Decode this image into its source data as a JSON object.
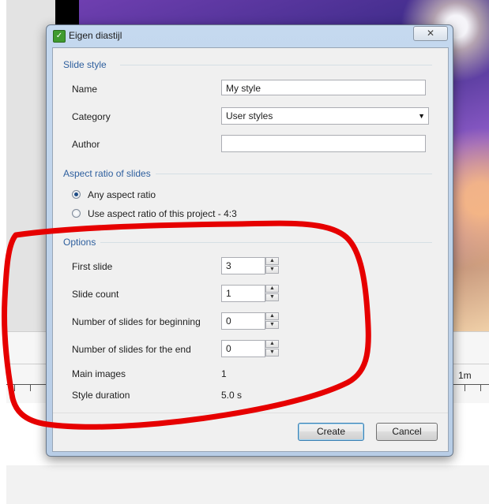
{
  "dialog": {
    "title": "Eigen diastijl",
    "close_glyph": "✕"
  },
  "slide_style": {
    "group_label": "Slide style",
    "name_label": "Name",
    "name_value": "My style",
    "category_label": "Category",
    "category_value": "User styles",
    "author_label": "Author",
    "author_value": ""
  },
  "aspect_ratio": {
    "group_label": "Aspect ratio of slides",
    "options": [
      {
        "label": "Any aspect ratio",
        "checked": true
      },
      {
        "label": "Use aspect ratio of this project - 4:3",
        "checked": false
      }
    ]
  },
  "options": {
    "group_label": "Options",
    "first_slide_label": "First slide",
    "first_slide_value": "3",
    "slide_count_label": "Slide count",
    "slide_count_value": "1",
    "beginning_label": "Number of slides for beginning",
    "beginning_value": "0",
    "end_label": "Number of slides for the end",
    "end_value": "0",
    "main_images_label": "Main images",
    "main_images_value": "1",
    "style_duration_label": "Style duration",
    "style_duration_value": "5.0 s"
  },
  "footer": {
    "create_label": "Create",
    "cancel_label": "Cancel"
  },
  "timeline": {
    "marker_label": "1m"
  },
  "colors": {
    "annotation": "#e60000",
    "group_heading": "#2e5f9e",
    "default_button_border": "#3c7fb1"
  }
}
